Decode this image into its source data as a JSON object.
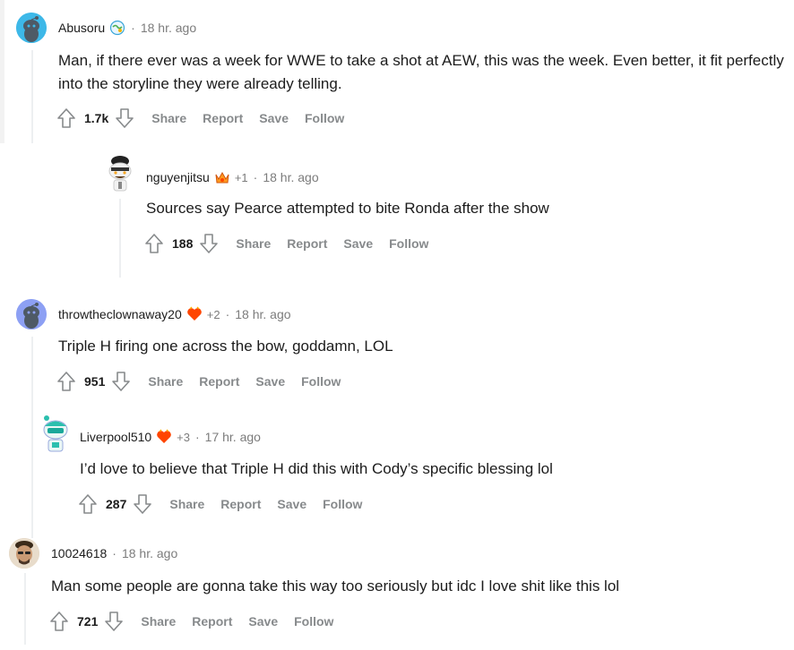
{
  "comments": [
    {
      "username": "Abusoru",
      "time": "18 hr. ago",
      "text": "Man, if there ever was a week for WWE to take a shot at AEW, this was the week. Even better, it fit perfectly into the storyline they were already telling.",
      "votes": "1.7k",
      "avatar_icon": "snoo-avatar-icon-blue",
      "flair_icon": "globe-flair-icon"
    },
    {
      "username": "nguyenjitsu",
      "plus": "+1",
      "time": "18 hr. ago",
      "text": "Sources say Pearce attempted to bite Ronda after the show",
      "votes": "188",
      "avatar_icon": "snoo-avatar-icon-cook",
      "flair_icon": "crown-flair-icon"
    },
    {
      "username": "throwtheclownaway20",
      "plus": "+2",
      "time": "18 hr. ago",
      "text": "Triple H firing one across the bow, goddamn, LOL",
      "votes": "951",
      "avatar_icon": "snoo-avatar-icon-purple",
      "flair_icon": "heart-flair-icon"
    },
    {
      "username": "Liverpool510",
      "plus": "+3",
      "time": "17 hr. ago",
      "text": "I’d love to believe that Triple H did this with Cody’s specific blessing lol",
      "votes": "287",
      "avatar_icon": "snoo-avatar-icon-teal",
      "flair_icon": "heart-flair-icon"
    },
    {
      "username": "10024618",
      "time": "18 hr. ago",
      "text": "Man some people are gonna take this way too seriously but idc I love shit like this lol",
      "votes": "721",
      "avatar_icon": "photo-avatar-icon"
    }
  ],
  "actions": {
    "share": "Share",
    "report": "Report",
    "save": "Save",
    "follow": "Follow"
  },
  "separator": "·",
  "colors": {
    "text": "#1c1c1c",
    "meta": "#7c7c7c",
    "action": "#878a8c",
    "thread_line": "#edeff1"
  }
}
